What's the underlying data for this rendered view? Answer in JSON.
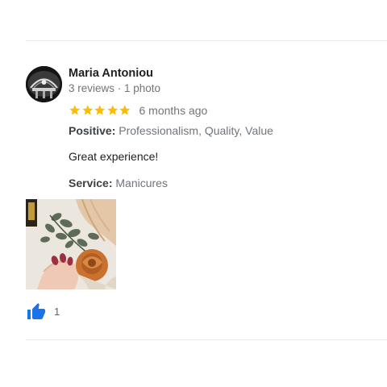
{
  "review": {
    "author_name": "Maria Antoniou",
    "author_meta": "3 reviews · 1 photo",
    "rating": 5,
    "rating_max": 5,
    "date": "6 months ago",
    "positive_label": "Positive:",
    "positive_value": "Professionalism, Quality, Value",
    "text": "Great experience!",
    "service_label": "Service:",
    "service_value": "Manicures",
    "like_count": "1"
  },
  "colors": {
    "star": "#fbbc04",
    "like": "#1a73e8",
    "divider": "#e8eaed",
    "muted_text": "#70757a"
  },
  "icons": {
    "like": "thumbs-up-icon",
    "star": "star-icon"
  }
}
